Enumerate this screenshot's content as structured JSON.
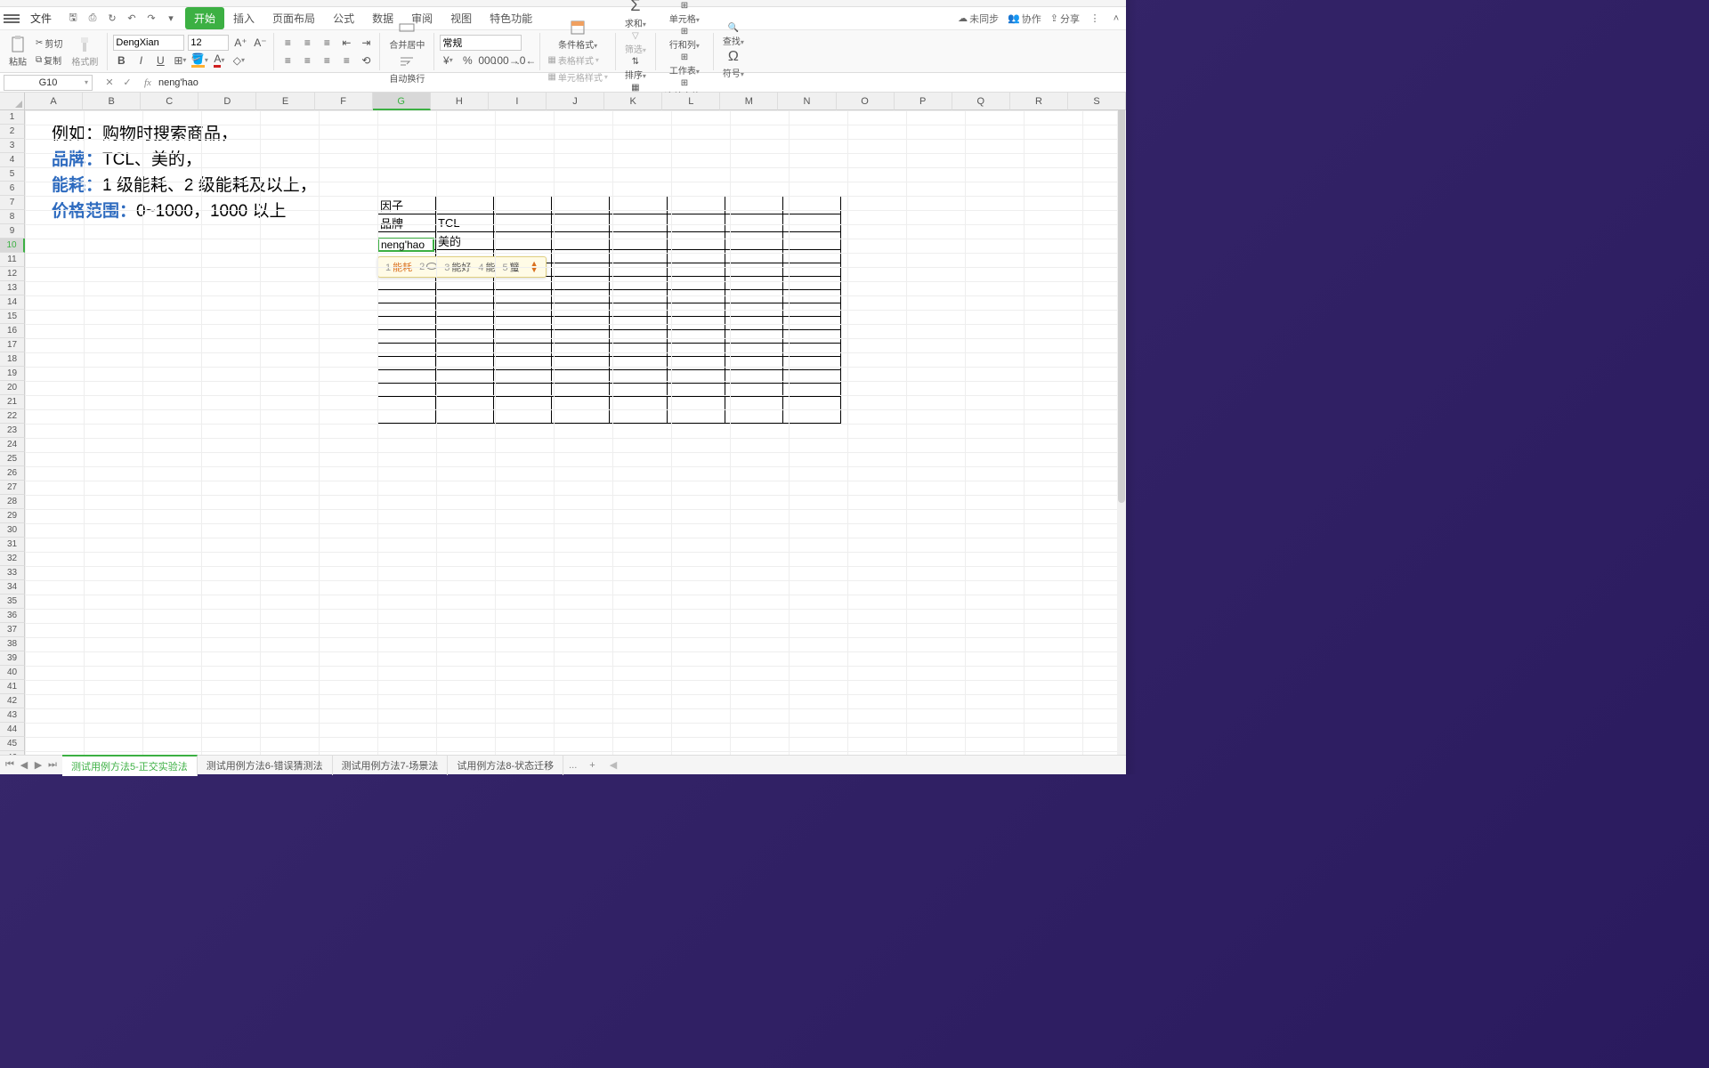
{
  "ribbon": {
    "file": "文件",
    "tabs": [
      "开始",
      "插入",
      "页面布局",
      "公式",
      "数据",
      "审阅",
      "视图",
      "特色功能"
    ],
    "active_tab": 0
  },
  "right_actions": {
    "unsync": "未同步",
    "collab": "协作",
    "share": "分享"
  },
  "toolbar": {
    "paste": "粘贴",
    "cut": "剪切",
    "copy": "复制",
    "format_painter": "格式刷",
    "font_name": "DengXian",
    "font_size": "12",
    "number_format": "常规",
    "merge_center": "合并居中",
    "wrap_text": "自动换行",
    "conditional_format": "条件格式",
    "table_style": "表格样式",
    "cell_style": "单元格样式",
    "sum": "求和",
    "filter": "筛选",
    "sort": "排序",
    "fill": "填充",
    "cells": "单元格",
    "rows_cols": "行和列",
    "worksheet": "工作表",
    "freeze": "冻结窗格",
    "find": "查找",
    "symbol": "符号"
  },
  "formula_bar": {
    "name_box": "G10",
    "formula": "neng'hao"
  },
  "columns": [
    "A",
    "B",
    "C",
    "D",
    "E",
    "F",
    "G",
    "H",
    "I",
    "J",
    "K",
    "L",
    "M",
    "N",
    "O",
    "P",
    "Q",
    "R",
    "S"
  ],
  "active_col": "G",
  "active_row": 10,
  "text_overlay": {
    "l1_prefix": "例如：",
    "l1_rest": "购物时搜索商品，",
    "l2_label": "品牌：",
    "l2_rest": "TCL、美的，",
    "l3_label": "能耗：",
    "l3_rest": "1 级能耗、2 级能耗及以上，",
    "l4_label": "价格范围：",
    "l4_rest": "0~1000，1000 以上"
  },
  "table": {
    "r1c1": "因子",
    "r2c1": "品牌",
    "r2c2": "TCL",
    "r3c2": "美的"
  },
  "editing": {
    "value": "neng'hao"
  },
  "ime": {
    "candidates": [
      {
        "n": "1",
        "t": "能耗",
        "sel": true
      },
      {
        "n": "2",
        "t": "",
        "icon": true
      },
      {
        "n": "3",
        "t": "能好"
      },
      {
        "n": "4",
        "t": "能"
      },
      {
        "n": "5",
        "t": "蠥"
      }
    ]
  },
  "sheets": {
    "tabs": [
      "测试用例方法5-正交实验法",
      "测试用例方法6-错误猜测法",
      "测试用例方法7-场景法",
      "试用例方法8-状态迁移"
    ],
    "active": 0,
    "more": "..."
  }
}
